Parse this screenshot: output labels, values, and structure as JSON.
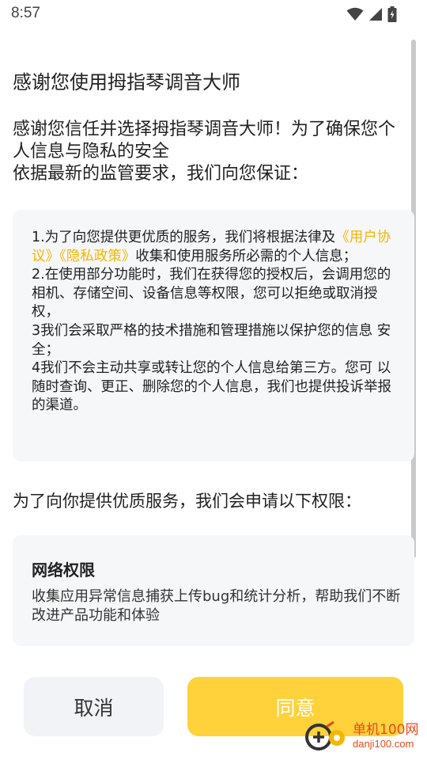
{
  "status_bar": {
    "time": "8:57",
    "icons": [
      "wifi-icon",
      "cellular-signal-icon",
      "battery-charging-icon"
    ]
  },
  "dialog": {
    "title": "感谢您使用拇指琴调音大师",
    "intro_line1": "感谢您信任并选择拇指琴调音大师！为了确保您个",
    "intro_line2": "人信息与隐私的安全",
    "intro_line3": "依据最新的监管要求，我们向您保证：",
    "notice": {
      "item1_prefix": "1.为了向您提供更优质的服务，我们将根据法律及",
      "user_agreement_link": "《用户协议》",
      "privacy_policy_link": "《隐私政策》",
      "item1_suffix": "收集和使用服务所必需的个人信息；",
      "item2": "2.在使用部分功能时，我们在获得您的授权后，会调用您的 相机、存储空间、设备信息等权限，您可以拒绝或取消授权，",
      "item3": "3我们会采取严格的技术措施和管理措施以保护您的信息 安全；",
      "item4": "4我们不会主动共享或转让您的个人信息给第三方。您可 以随时查询、更正、删除您的个人信息，我们也提供投诉举报的渠道。"
    },
    "permission_intro": "为了向你提供优质服务，我们会申请以下权限：",
    "permission": {
      "title": "网络权限",
      "description": "收集应用异常信息捕获上传bug和统计分析，帮助我们不断改进产品功能和体验"
    },
    "cancel_label": "取消",
    "agree_label": "同意"
  },
  "watermark": {
    "logo_icon": "danji-logo-icon",
    "name_cn": "单机100网",
    "name_en": "danji100.com"
  },
  "colors": {
    "accent": "#ffd23b",
    "link": "#f5b700",
    "card_bg": "#f6f7f9",
    "cancel_bg": "#f2f3f7"
  }
}
